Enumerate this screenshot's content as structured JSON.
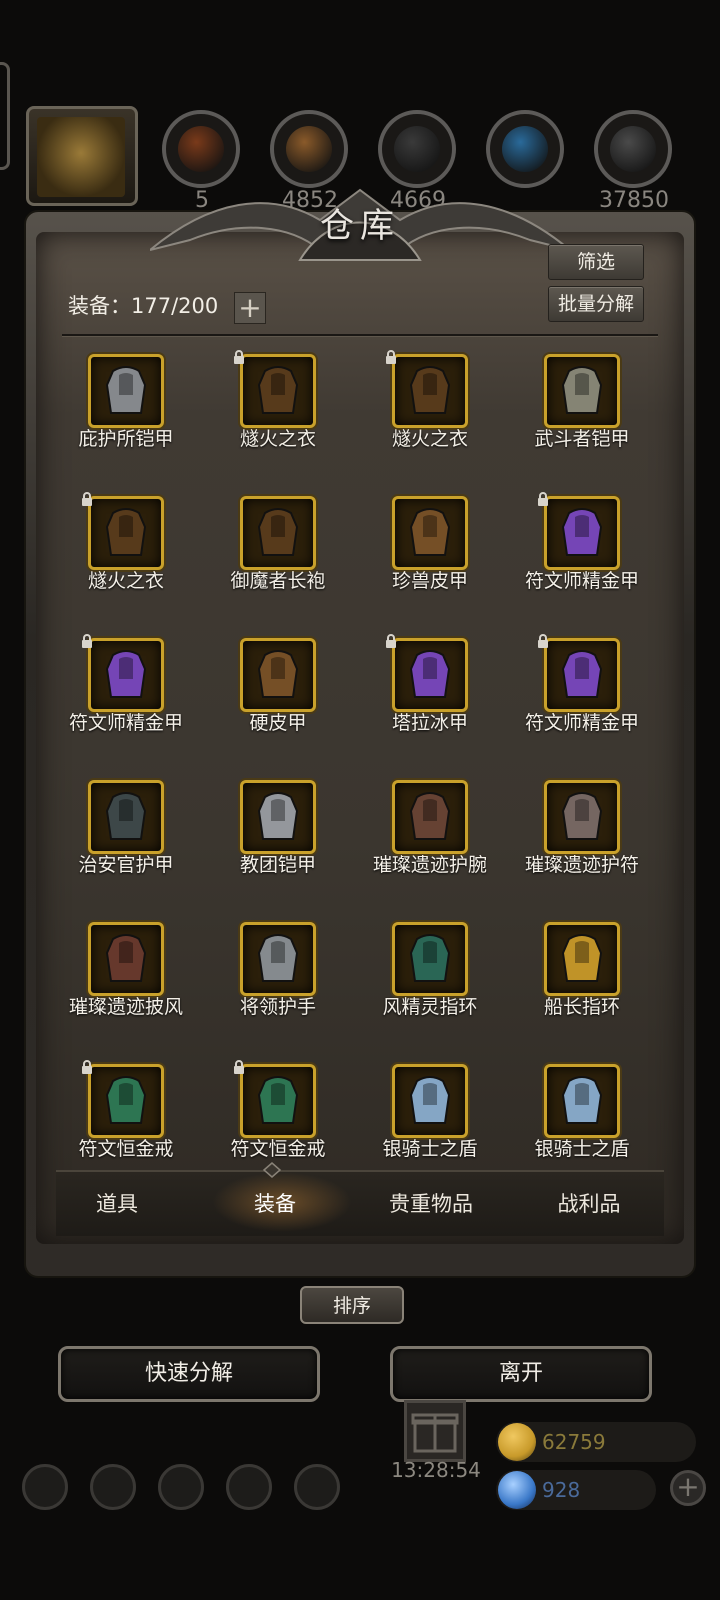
{
  "top_bar": {
    "resources": [
      {
        "icon": "leather-resource-icon",
        "color": "#7a3a1a",
        "value": "5"
      },
      {
        "icon": "wood-resource-icon",
        "color": "#8a5a2a",
        "value": "4852"
      },
      {
        "icon": "iron-resource-icon",
        "color": "#3a3a3a",
        "value": "4669"
      },
      {
        "icon": "crystal-resource-icon",
        "color": "#2a6a9a",
        "value": ""
      },
      {
        "icon": "ore-resource-icon",
        "color": "#4a4a4a",
        "value": "37850"
      }
    ]
  },
  "warehouse": {
    "title": "仓库",
    "filter_label": "筛选",
    "batch_decompose_label": "批量分解",
    "equipment_count": "装备：177/200",
    "expand_label": "+",
    "items": [
      {
        "name": "庇护所铠甲",
        "locked": false,
        "icon": "plate-armor-icon",
        "color": "#8a8e94"
      },
      {
        "name": "燧火之衣",
        "locked": true,
        "icon": "hooded-robe-icon",
        "color": "#5a3c1c"
      },
      {
        "name": "燧火之衣",
        "locked": true,
        "icon": "hooded-robe-icon",
        "color": "#5a3c1c"
      },
      {
        "name": "武斗者铠甲",
        "locked": false,
        "icon": "chest-armor-icon",
        "color": "#8a8a7a"
      },
      {
        "name": "燧火之衣",
        "locked": true,
        "icon": "hooded-robe-icon",
        "color": "#5a3c1c"
      },
      {
        "name": "御魔者长袍",
        "locked": false,
        "icon": "hooded-robe-icon",
        "color": "#5a3c1c"
      },
      {
        "name": "珍兽皮甲",
        "locked": false,
        "icon": "leather-armor-icon",
        "color": "#7a5228"
      },
      {
        "name": "符文师精金甲",
        "locked": true,
        "icon": "purple-armor-icon",
        "color": "#7a48c0"
      },
      {
        "name": "符文师精金甲",
        "locked": true,
        "icon": "purple-armor-icon",
        "color": "#7a48c0"
      },
      {
        "name": "硬皮甲",
        "locked": false,
        "icon": "leather-armor-icon",
        "color": "#7a5228"
      },
      {
        "name": "塔拉冰甲",
        "locked": true,
        "icon": "purple-armor-icon",
        "color": "#7a48c0"
      },
      {
        "name": "符文师精金甲",
        "locked": true,
        "icon": "purple-armor-icon",
        "color": "#7a48c0"
      },
      {
        "name": "治安官护甲",
        "locked": false,
        "icon": "dark-armor-icon",
        "color": "#3e4a4c"
      },
      {
        "name": "教团铠甲",
        "locked": false,
        "icon": "plate-armor-icon",
        "color": "#9a9ea4"
      },
      {
        "name": "璀璨遗迹护腕",
        "locked": false,
        "icon": "bracer-icon",
        "color": "#6a4436"
      },
      {
        "name": "璀璨遗迹护符",
        "locked": false,
        "icon": "amulet-icon",
        "color": "#7a6a66"
      },
      {
        "name": "璀璨遗迹披风",
        "locked": false,
        "icon": "cloak-icon",
        "color": "#6a3a2e"
      },
      {
        "name": "将领护手",
        "locked": false,
        "icon": "gauntlet-icon",
        "color": "#8a9096"
      },
      {
        "name": "风精灵指环",
        "locked": false,
        "icon": "jade-ring-icon",
        "color": "#2a6a5a"
      },
      {
        "name": "船长指环",
        "locked": false,
        "icon": "gold-ring-icon",
        "color": "#c89a2a"
      },
      {
        "name": "符文恒金戒",
        "locked": true,
        "icon": "green-ring-icon",
        "color": "#2e7a56"
      },
      {
        "name": "符文恒金戒",
        "locked": true,
        "icon": "green-ring-icon",
        "color": "#2e7a56"
      },
      {
        "name": "银骑士之盾",
        "locked": false,
        "icon": "shield-icon",
        "color": "#8aaed0"
      },
      {
        "name": "银骑士之盾",
        "locked": false,
        "icon": "shield-icon",
        "color": "#8aaed0"
      }
    ],
    "tabs": [
      {
        "label": "道具",
        "active": false
      },
      {
        "label": "装备",
        "active": true
      },
      {
        "label": "贵重物品",
        "active": false
      },
      {
        "label": "战利品",
        "active": false
      }
    ],
    "sort_label": "排序"
  },
  "actions": {
    "quick_decompose_label": "快速分解",
    "leave_label": "离开"
  },
  "footer": {
    "timer": "13:28:54",
    "gold": "62759",
    "gems": "928",
    "gold_color": "#c89a2a",
    "gem_color": "#3a78c8"
  }
}
